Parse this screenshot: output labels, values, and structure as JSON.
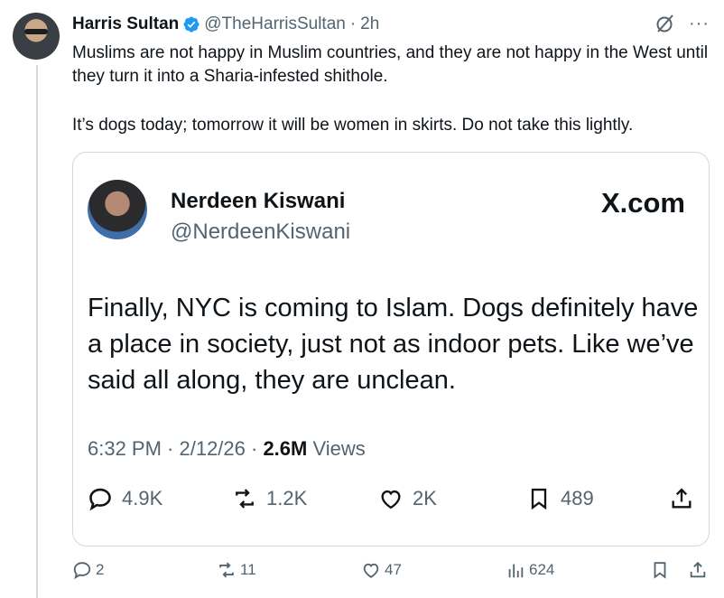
{
  "post": {
    "author_name": "Harris Sultan",
    "author_handle": "@TheHarrisSultan",
    "separator": "·",
    "time": "2h",
    "text_line1": "Muslims are not happy in Muslim countries, and they are not happy in the West until they turn it into a Sharia-infested shithole.",
    "text_line2": "It’s dogs today; tomorrow it will be women in skirts. Do not take this lightly.",
    "more_label": "···"
  },
  "quote": {
    "author_name": "Nerdeen Kiswani",
    "author_handle": "@NerdeenKiswani",
    "brand": "X.com",
    "text": "Finally, NYC is coming to Islam. Dogs definitely have a place in society, just not as indoor pets. Like we’ve said all along, they are unclean.",
    "timestamp": "6:32 PM · 2/12/26 · ",
    "views_count": "2.6M",
    "views_label": " Views",
    "replies": "4.9K",
    "reposts": "1.2K",
    "likes": "2K",
    "bookmarks": "489"
  },
  "actions": {
    "replies": "2",
    "reposts": "11",
    "likes": "47",
    "views": "624"
  },
  "colors": {
    "verified_blue": "#1d9bf0",
    "muted_text": "#536471",
    "border": "#cfd9de"
  },
  "icons": [
    "verified-badge-icon",
    "grok-icon",
    "more-icon",
    "reply-icon",
    "repost-icon",
    "like-icon",
    "bookmark-icon",
    "share-icon",
    "views-icon"
  ]
}
